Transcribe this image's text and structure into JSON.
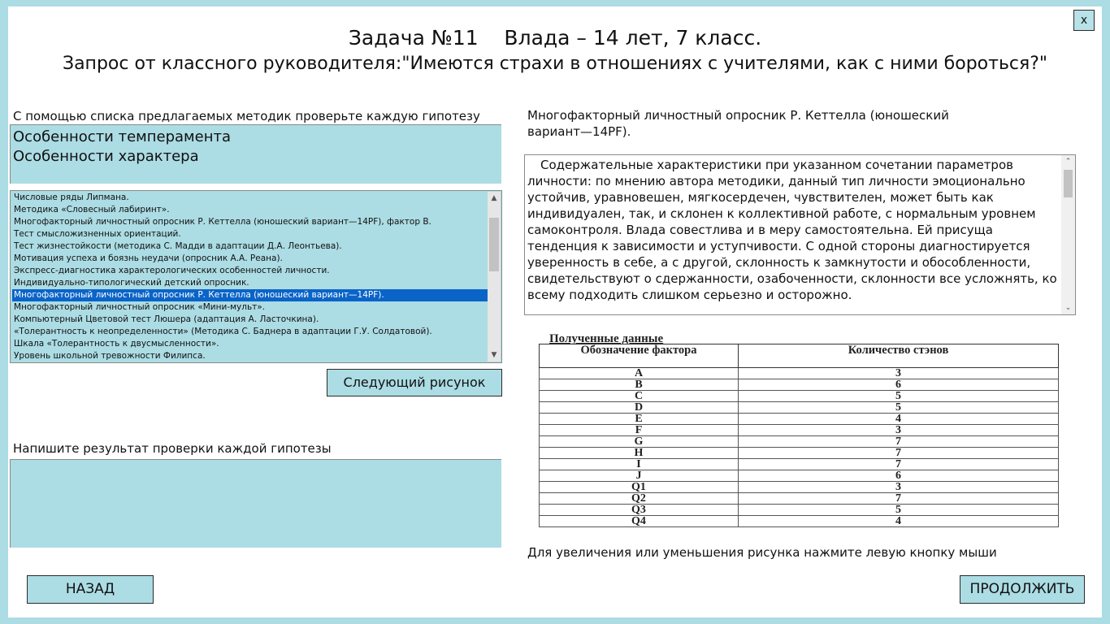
{
  "window": {
    "close_label": "x"
  },
  "header": {
    "task_title": "Задача №11    Влада – 14 лет, 7 класс.",
    "request": "Запрос от классного руководителя:\"Имеются страхи в отношениях с учителями, как с ними бороться?\""
  },
  "left": {
    "hypotheses_label": "С помощью списка предлагаемых методик проверьте каждую гипотезу",
    "hypotheses": [
      "Особенности темперамента",
      "Особенности характера"
    ],
    "methods": [
      "Числовые ряды Липмана.",
      "Методика «Словесный лабиринт».",
      "Многофакторный личностный опросник Р. Кеттелла (юношеский вариант—14PF), фактор В.",
      "Тест смысложизненных ориентаций.",
      "Тест жизнестойкости (методика С. Мадди в адаптации Д.А. Леонтьева).",
      "Мотивация успеха и боязнь неудачи (опросник А.А. Реана).",
      "Экспресс-диагностика характерологических особенностей личности.",
      "Индивидуально-типологический детский опросник.",
      "Многофакторный личностный опросник Р. Кеттелла (юношеский вариант—14PF).",
      "Многофакторный личностный опросник «Мини-мульт».",
      "Компьютерный Цветовой тест Люшера (адаптация А. Ласточкина).",
      "«Толерантность к неопределенности» (Методика С. Баднера в адаптации Г.У. Солдатовой).",
      "Шкала «Толерантность к двусмысленности».",
      "Уровень школьной тревожности Филипса."
    ],
    "selected_method_index": 8,
    "next_picture_label": "Следующий рисунок",
    "result_label": "Напишите результат проверки каждой гипотезы",
    "result_value": ""
  },
  "right": {
    "method_name": "Многофакторный личностный опросник Р. Кеттелла (юношеский вариант—14PF).",
    "description": "Содержательные характеристики при указанном сочетании параметров личности: по мнению автора методики, данный тип личности эмоционально устойчив, уравновешен, мягкосердечен, чувствителен, может быть как индивидуален, так, и склонен к коллективной работе, с нормальным уровнем самоконтроля. Влада совестлива и в меру самостоятельна. Ей присуща тенденция к зависимости и уступчивости. С одной стороны диагностируется уверенность в себе, а с другой, склонность к замкнутости и обособленности, свидетельствуют о сдержанности, озабоченности, склонности все усложнять, ко всему подходить слишком серьезно и осторожно.",
    "data_caption": "Полученные данные",
    "table": {
      "headers": [
        "Обозначение фактора",
        "Количество стэнов"
      ],
      "rows": [
        [
          "A",
          "3"
        ],
        [
          "B",
          "6"
        ],
        [
          "C",
          "5"
        ],
        [
          "D",
          "5"
        ],
        [
          "E",
          "4"
        ],
        [
          "F",
          "3"
        ],
        [
          "G",
          "7"
        ],
        [
          "H",
          "7"
        ],
        [
          "I",
          "7"
        ],
        [
          "J",
          "6"
        ],
        [
          "Q1",
          "3"
        ],
        [
          "Q2",
          "7"
        ],
        [
          "Q3",
          "5"
        ],
        [
          "Q4",
          "4"
        ]
      ]
    },
    "zoom_hint": "Для увеличения или уменьшения рисунка нажмите левую кнопку мыши"
  },
  "footer": {
    "back_label": "НАЗАД",
    "continue_label": "ПРОДОЛЖИТЬ"
  },
  "colors": {
    "panel_background": "#acdce4",
    "selection": "#0a64c8"
  }
}
